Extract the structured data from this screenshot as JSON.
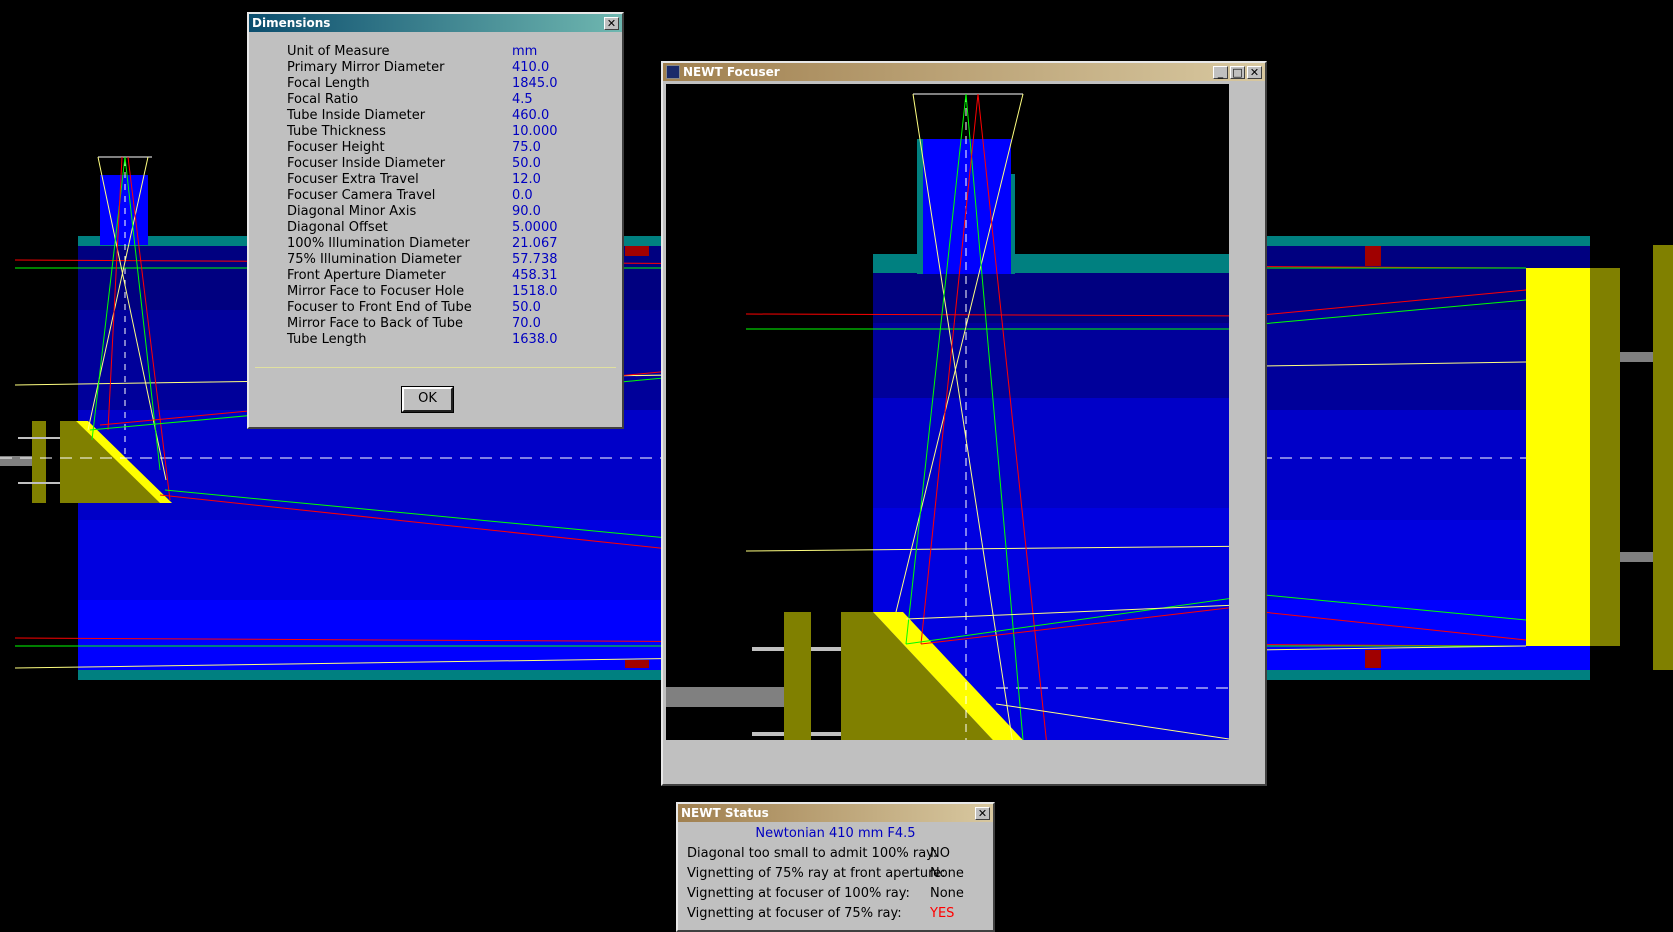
{
  "dimensions_dialog": {
    "title": "Dimensions",
    "close_glyph": "✕",
    "rows": [
      {
        "label": "Unit of Measure",
        "value": "mm"
      },
      {
        "label": "Primary Mirror Diameter",
        "value": "410.0"
      },
      {
        "label": "Focal Length",
        "value": "1845.0"
      },
      {
        "label": "Focal Ratio",
        "value": "4.5"
      },
      {
        "label": "Tube Inside Diameter",
        "value": "460.0"
      },
      {
        "label": "Tube Thickness",
        "value": "10.000"
      },
      {
        "label": "Focuser Height",
        "value": "75.0"
      },
      {
        "label": "Focuser Inside Diameter",
        "value": "50.0"
      },
      {
        "label": "Focuser Extra Travel",
        "value": "12.0"
      },
      {
        "label": "Focuser Camera Travel",
        "value": "0.0"
      },
      {
        "label": "Diagonal Minor Axis",
        "value": "90.0"
      },
      {
        "label": "Diagonal Offset",
        "value": "5.0000"
      },
      {
        "label": "100% Illumination Diameter",
        "value": "21.067"
      },
      {
        "label": "75% Illumination Diameter",
        "value": "57.738"
      },
      {
        "label": "Front Aperture Diameter",
        "value": "458.31"
      },
      {
        "label": "Mirror Face to Focuser Hole",
        "value": "1518.0"
      },
      {
        "label": "Focuser to Front End of Tube",
        "value": "50.0"
      },
      {
        "label": "Mirror Face to Back of Tube",
        "value": "70.0"
      },
      {
        "label": "Tube Length",
        "value": "1638.0"
      }
    ],
    "ok_label": "OK"
  },
  "focuser_window": {
    "title": "NEWT Focuser",
    "minimize_glyph": "_",
    "maximize_glyph": "□",
    "close_glyph": "✕"
  },
  "status_window": {
    "title": "NEWT Status",
    "close_glyph": "✕",
    "heading": "Newtonian 410 mm F4.5",
    "rows": [
      {
        "label": "Diagonal too small to admit 100% ray:",
        "value": "NO",
        "color": "#000000"
      },
      {
        "label": "Vignetting of 75% ray at front aperture:",
        "value": "None",
        "color": "#000000"
      },
      {
        "label": "Vignetting at focuser of 100% ray:",
        "value": "None",
        "color": "#000000"
      },
      {
        "label": "Vignetting at focuser of 75% ray:",
        "value": "YES",
        "color": "#ff0000"
      }
    ]
  },
  "colors": {
    "tube_blue": "#0000ff",
    "tube_wall": "#008080",
    "mirror": "#ffff00",
    "diagonal_holder": "#808000",
    "ray_red": "#ff0000",
    "ray_green": "#00ff00",
    "ray_yellow": "#ffff80"
  }
}
